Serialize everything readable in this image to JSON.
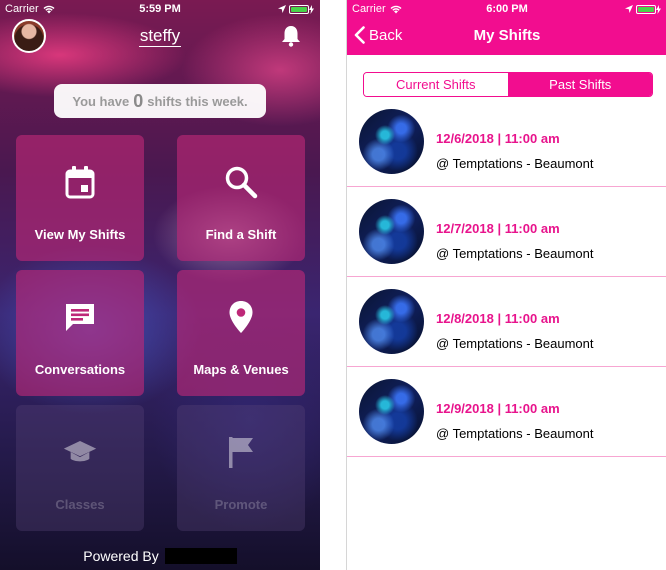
{
  "left": {
    "status": {
      "carrier": "Carrier",
      "time": "5:59 PM"
    },
    "username": "steffy",
    "shift_summary": {
      "prefix": "You have",
      "count": "0",
      "suffix": "shifts this week."
    },
    "tiles": [
      {
        "label": "View My Shifts",
        "icon": "calendar-icon",
        "enabled": true
      },
      {
        "label": "Find a Shift",
        "icon": "search-icon",
        "enabled": true
      },
      {
        "label": "Conversations",
        "icon": "chat-icon",
        "enabled": true
      },
      {
        "label": "Maps & Venues",
        "icon": "map-pin-icon",
        "enabled": true
      },
      {
        "label": "Classes",
        "icon": "graduation-cap-icon",
        "enabled": false
      },
      {
        "label": "Promote",
        "icon": "flag-icon",
        "enabled": false
      }
    ],
    "footer": {
      "powered_by": "Powered By"
    }
  },
  "right": {
    "status": {
      "carrier": "Carrier",
      "time": "6:00 PM"
    },
    "nav": {
      "back_label": "Back",
      "title": "My Shifts"
    },
    "segments": {
      "current": "Current Shifts",
      "past": "Past Shifts",
      "selected": "past"
    },
    "shifts": [
      {
        "datetime": "12/6/2018 | 11:00 am",
        "venue": "@ Temptations - Beaumont"
      },
      {
        "datetime": "12/7/2018 | 11:00 am",
        "venue": "@ Temptations - Beaumont"
      },
      {
        "datetime": "12/8/2018 | 11:00 am",
        "venue": "@ Temptations - Beaumont"
      },
      {
        "datetime": "12/9/2018 | 11:00 am",
        "venue": "@ Temptations - Beaumont"
      }
    ]
  },
  "colors": {
    "accent": "#f20d8f",
    "tile": "#be2878",
    "list_date": "#e8138c"
  }
}
